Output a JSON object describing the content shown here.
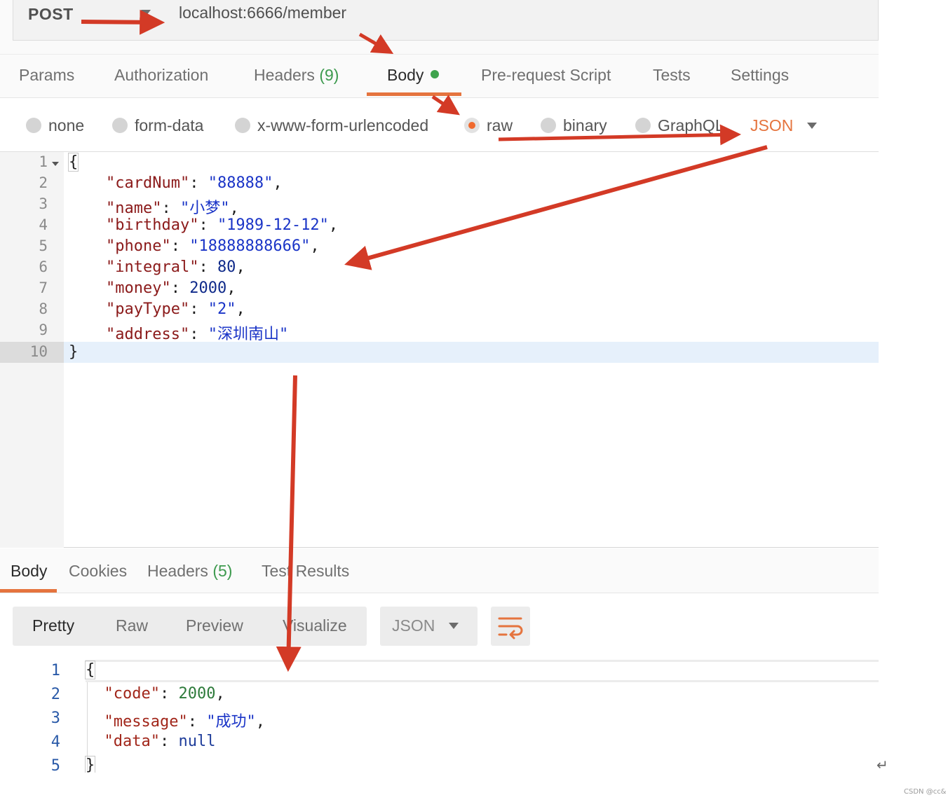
{
  "request": {
    "method": "POST",
    "url": "localhost:6666/member"
  },
  "request_tabs": [
    {
      "label": "Params"
    },
    {
      "label": "Authorization"
    },
    {
      "label": "Headers",
      "count": "(9)"
    },
    {
      "label": "Body",
      "indicator": "green-dot",
      "active": true
    },
    {
      "label": "Pre-request Script"
    },
    {
      "label": "Tests"
    },
    {
      "label": "Settings"
    }
  ],
  "body_types": [
    {
      "label": "none",
      "checked": false
    },
    {
      "label": "form-data",
      "checked": false
    },
    {
      "label": "x-www-form-urlencoded",
      "checked": false
    },
    {
      "label": "raw",
      "checked": true
    },
    {
      "label": "binary",
      "checked": false
    },
    {
      "label": "GraphQL",
      "checked": false
    }
  ],
  "raw_format": "JSON",
  "request_body": {
    "line_numbers": [
      "1",
      "2",
      "3",
      "4",
      "5",
      "6",
      "7",
      "8",
      "9",
      "10"
    ],
    "open_brace": "{",
    "close_brace": "}",
    "fields": [
      {
        "key": "\"cardNum\"",
        "value": "\"88888\"",
        "type": "string",
        "sep": ","
      },
      {
        "key": "\"name\"",
        "value": "\"小梦\"",
        "type": "string",
        "sep": ","
      },
      {
        "key": "\"birthday\"",
        "value": "\"1989-12-12\"",
        "type": "string",
        "sep": ","
      },
      {
        "key": "\"phone\"",
        "value": "\"18888888666\"",
        "type": "string",
        "sep": ","
      },
      {
        "key": "\"integral\"",
        "value": "80",
        "type": "number",
        "sep": ","
      },
      {
        "key": "\"money\"",
        "value": "2000",
        "type": "number",
        "sep": ","
      },
      {
        "key": "\"payType\"",
        "value": "\"2\"",
        "type": "string",
        "sep": ","
      },
      {
        "key": "\"address\"",
        "value": "\"深圳南山\"",
        "type": "string",
        "sep": ""
      }
    ]
  },
  "response_tabs": [
    {
      "label": "Body",
      "active": true
    },
    {
      "label": "Cookies"
    },
    {
      "label": "Headers",
      "count": "(5)"
    },
    {
      "label": "Test Results"
    }
  ],
  "response_views": [
    {
      "label": "Pretty",
      "active": true
    },
    {
      "label": "Raw"
    },
    {
      "label": "Preview"
    },
    {
      "label": "Visualize"
    }
  ],
  "response_format": "JSON",
  "wrap_icon": "wrap-lines-icon",
  "response_body": {
    "line_numbers": [
      "1",
      "2",
      "3",
      "4",
      "5"
    ],
    "open_brace": "{",
    "close_brace": "}",
    "fields": [
      {
        "key": "\"code\"",
        "value": "2000",
        "type": "number",
        "sep": ","
      },
      {
        "key": "\"message\"",
        "value": "\"成功\"",
        "type": "string",
        "sep": ","
      },
      {
        "key": "\"data\"",
        "value": "null",
        "type": "null",
        "sep": ""
      }
    ]
  },
  "return_symbol": "↵",
  "watermark": "CSDN @cc&",
  "colors": {
    "accent": "#e5743e",
    "active_dot": "#3fa34d",
    "annotation_arrow": "#d33a26",
    "string_value": "#1a34c7",
    "key": "#8b1a1a"
  }
}
